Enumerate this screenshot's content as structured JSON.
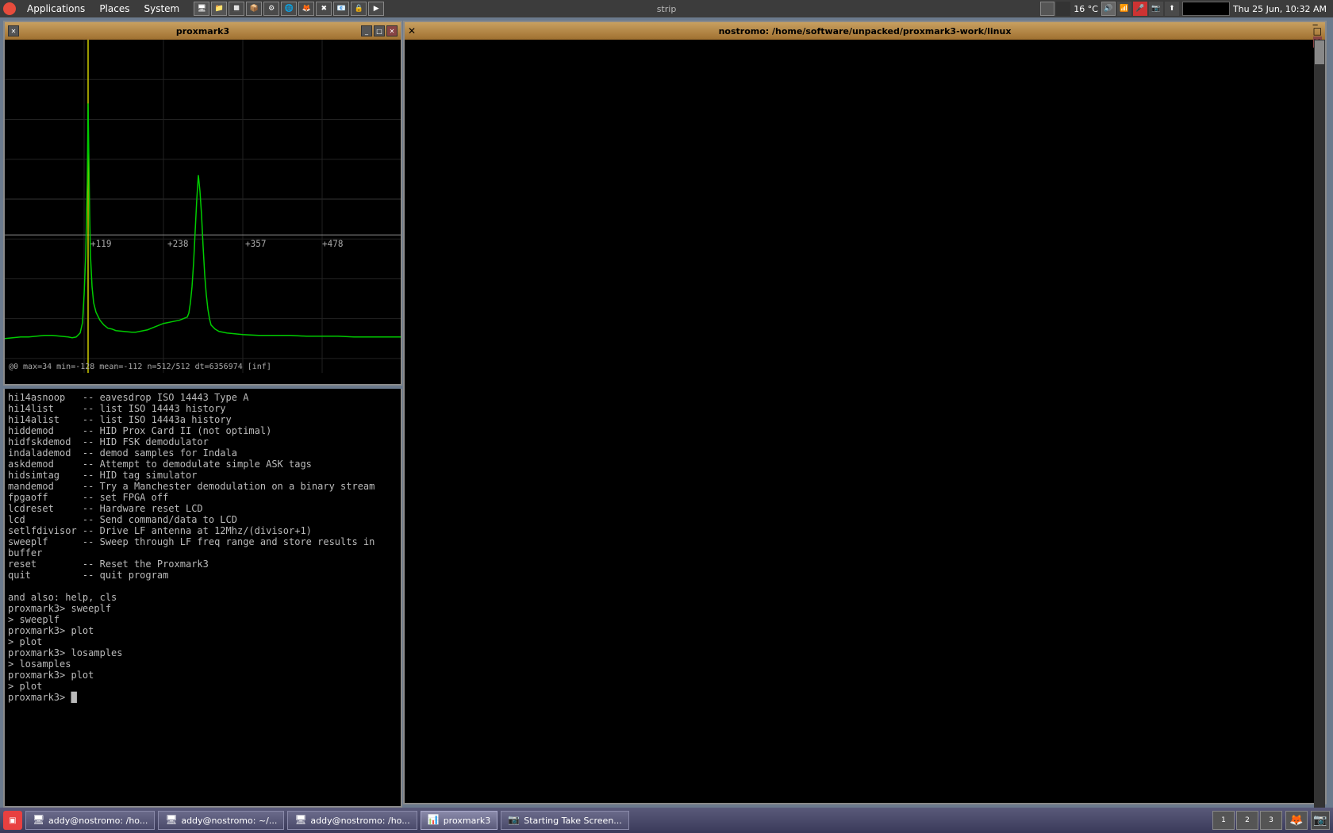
{
  "menubar": {
    "applications": "Applications",
    "places": "Places",
    "system": "System"
  },
  "topbar_right": {
    "temp": "16 °C",
    "time": "Thu 25 Jun, 10:32 AM"
  },
  "proxmark_window": {
    "title": "proxmark3",
    "plot_status": "@0  max=34  min=-128  mean=-112  n=512/512    dt=6356974 [inf]",
    "axis_labels": [
      "+119",
      "+238",
      "+357",
      "+478"
    ]
  },
  "terminal_window": {
    "title": "nostromo: /home/software/unpacked/proxmark3-work/linux"
  },
  "terminal_content": {
    "lines": [
      "hi14asnoop   -- eavesdrop ISO 14443 Type A",
      "hi14list     -- list ISO 14443 history",
      "hi14alist    -- list ISO 14443a history",
      "hiddemod     -- HID Prox Card II (not optimal)",
      "hidfskdemod  -- HID FSK demodulator",
      "indalademod  -- demod samples for Indala",
      "askdemod     -- Attempt to demodulate simple ASK tags",
      "hidsimtag    -- HID tag simulator",
      "mandemod     -- Try a Manchester demodulation on a binary stream",
      "fpgaoff      -- set FPGA off",
      "lcdreset     -- Hardware reset LCD",
      "lcd          -- Send command/data to LCD",
      "setlfdivisor -- Drive LF antenna at 12Mhz/(divisor+1)",
      "sweeplf      -- Sweep through LF freq range and store results in buffer",
      "reset        -- Reset the Proxmark3",
      "quit         -- quit program",
      "",
      "and also: help, cls",
      "proxmark3> sweeplf",
      "> sweeplf",
      "proxmark3> plot",
      "> plot",
      "proxmark3> losamples",
      "> losamples",
      "proxmark3> plot",
      "> plot",
      "proxmark3> █"
    ]
  },
  "taskbar": {
    "items": [
      {
        "label": "addy@nostromo: /ho...",
        "icon": "terminal"
      },
      {
        "label": "addy@nostromo: ~/...",
        "icon": "terminal"
      },
      {
        "label": "addy@nostromo: /ho...",
        "icon": "terminal"
      },
      {
        "label": "proxmark3",
        "icon": "app"
      },
      {
        "label": "Starting Take Screen...",
        "icon": "camera"
      }
    ]
  }
}
